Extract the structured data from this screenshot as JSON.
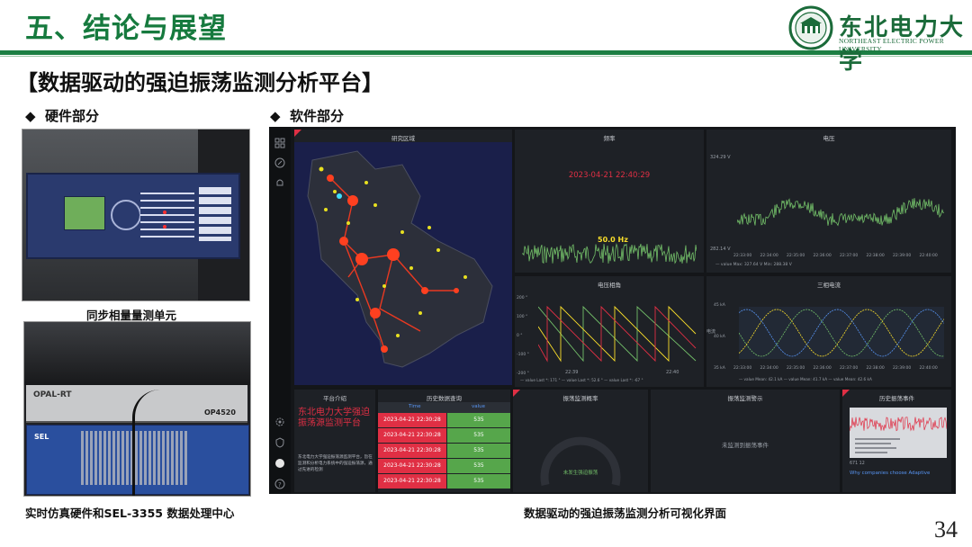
{
  "slide": {
    "title": "五、结论与展望",
    "heading": "【数据驱动的强迫振荡监测分析平台】",
    "hardware_label": "硬件部分",
    "software_label": "软件部分",
    "bullet": "◆",
    "caption_pmu": "同步相量量测单元",
    "caption_hw": "实时仿真硬件和SEL-3355 数据处理中心",
    "caption_ui": "数据驱动的强迫振荡监测分析可视化界面",
    "page_number": "34"
  },
  "university": {
    "name_cn": "东北电力大学",
    "name_en": "NORTHEAST ELECTRIC POWER UNIVERSITY"
  },
  "photos": {
    "opal_brand": "OPAL-RT",
    "opal_model": "OP4520",
    "sel_brand": "SEL"
  },
  "dashboard": {
    "map_panel": {
      "title": "研究区域"
    },
    "freq_panel": {
      "title": "频率",
      "timestamp": "2023-04-21 22:40:29",
      "value": "50.0 Hz"
    },
    "voltage_panel": {
      "title": "电压",
      "y_top": "324.29 V",
      "y_bottom": "282.14 V",
      "x_ticks": [
        "22:33:00",
        "22:34:00",
        "22:35:00",
        "22:36:00",
        "22:37:00",
        "22:38:00",
        "22:39:00",
        "22:40:00"
      ],
      "legend": "— value  Max: 327.64 V  Min: 288.38 V"
    },
    "phase_panel": {
      "title": "电压相角",
      "y_ticks": [
        "200 °",
        "100 °",
        "0 °",
        "-100 °",
        "-200 °"
      ],
      "x_ticks": [
        "22:39",
        "22:40"
      ],
      "legend": "— value  Last *: 171 °   — value  Last *: 52.6 °   — value  Last *: -67 °"
    },
    "current_panel": {
      "title": "三相电流",
      "y_ticks": [
        "45 kA",
        "40 kA",
        "35 kA"
      ],
      "y_label": "电流",
      "x_ticks": [
        "22:33:00",
        "22:34:00",
        "22:35:00",
        "22:36:00",
        "22:37:00",
        "22:38:00",
        "22:39:00",
        "22:40:00"
      ],
      "legend": "— value  Mean: 42.1 kA   — value  Mean: 41.7 kA   — value  Mean: 42.6 kA"
    },
    "intro_panel": {
      "title": "平台介绍",
      "heading": "东北电力大学强迫振荡源监测平台",
      "body": "东北电力大学强迫振荡源监测平台，旨在监测和分析电力系统中的强迫振荡源，通过先进的检测"
    },
    "history_panel": {
      "title": "历史数据查询",
      "columns": [
        "Time",
        "value"
      ],
      "rows": [
        {
          "time": "2023-04-21 22:30:28",
          "value": "535"
        },
        {
          "time": "2023-04-21 22:30:28",
          "value": "535"
        },
        {
          "time": "2023-04-21 22:30:28",
          "value": "535"
        },
        {
          "time": "2023-04-21 22:30:28",
          "value": "535"
        },
        {
          "time": "2023-04-21 22:30:28",
          "value": "535"
        }
      ]
    },
    "prob_panel": {
      "title": "振荡监测概率",
      "gauge_text": "未发生强迫振荡"
    },
    "alarm_panel": {
      "title": "振荡监测警示",
      "message": "未监测到振荡事件"
    },
    "event_panel": {
      "title": "历史振荡事件",
      "footer_small": "671 12",
      "link": "Why companies choose Adaptive"
    },
    "colors": {
      "bg": "#141619",
      "panel": "#1e2126",
      "green_line": "#73bf69",
      "red": "#e02f44",
      "yellow": "#fade2a",
      "orange": "#ff9830",
      "blue": "#5794f2",
      "map_bg": "#1a1f4a"
    },
    "icons": [
      "apps-icon",
      "compass-icon",
      "bell-icon",
      "gear-icon",
      "shield-icon",
      "user-icon",
      "help-icon"
    ]
  }
}
